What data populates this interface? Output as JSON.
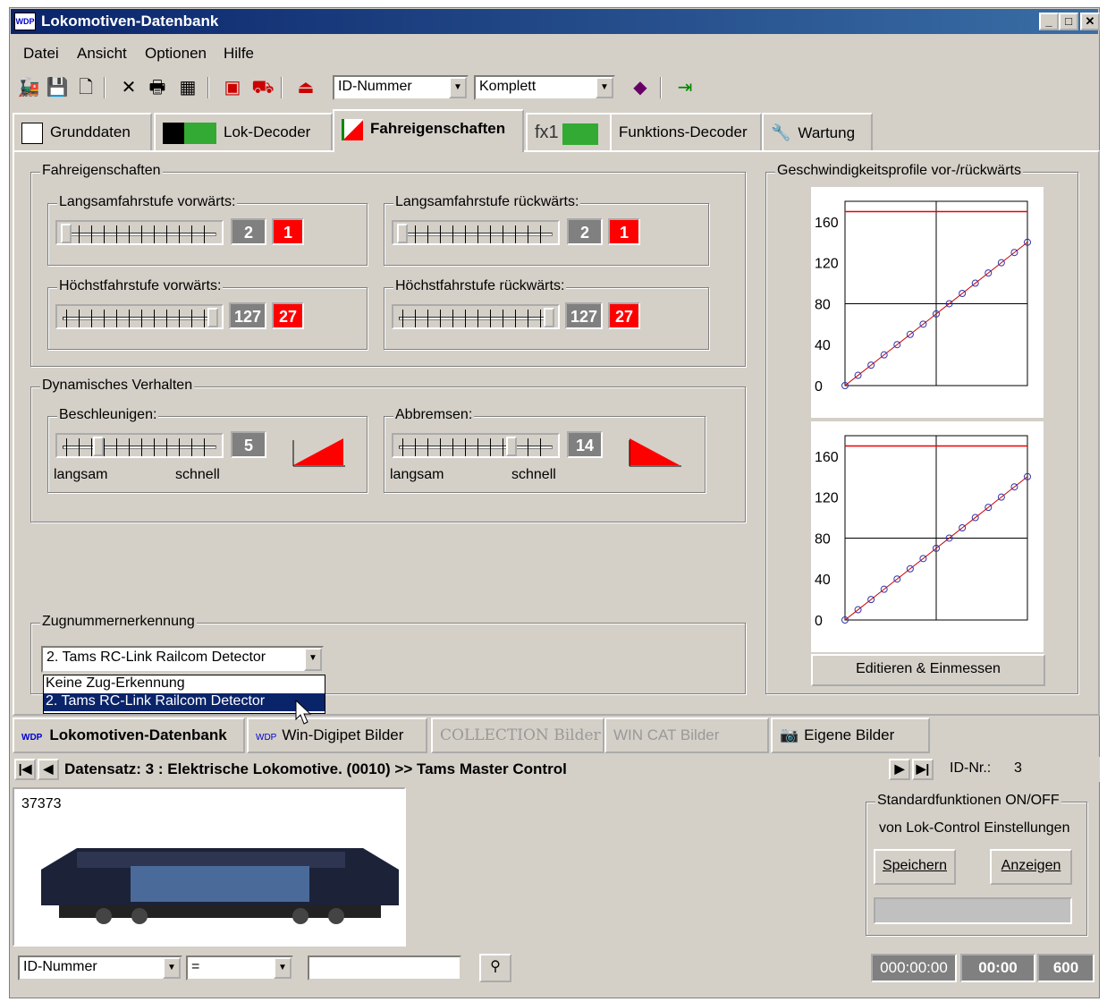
{
  "window": {
    "title": "Lokomotiven-Datenbank",
    "icon_text": "WDP"
  },
  "menu": [
    {
      "label": "Datei"
    },
    {
      "label": "Ansicht"
    },
    {
      "label": "Optionen"
    },
    {
      "label": "Hilfe"
    }
  ],
  "toolbar": {
    "field_combo": "ID-Nummer",
    "mode_combo": "Komplett"
  },
  "tabs": [
    {
      "label": "Grunddaten"
    },
    {
      "label": "Lok-Decoder"
    },
    {
      "label": "Fahreigenschaften"
    },
    {
      "label": "fx1"
    },
    {
      "label": "Funktions-Decoder"
    },
    {
      "label": "Wartung"
    }
  ],
  "fahr": {
    "legend": "Fahreigenschaften",
    "lang_vor": {
      "label": "Langsamfahrstufe vorwärts:",
      "value": "2",
      "red": "1"
    },
    "lang_rueck": {
      "label": "Langsamfahrstufe rückwärts:",
      "value": "2",
      "red": "1"
    },
    "hoch_vor": {
      "label": "Höchstfahrstufe vorwärts:",
      "value": "127",
      "red": "27"
    },
    "hoch_rueck": {
      "label": "Höchstfahrstufe rückwärts:",
      "value": "127",
      "red": "27"
    }
  },
  "dyn": {
    "legend": "Dynamisches Verhalten",
    "beschl": {
      "label": "Beschleunigen:",
      "value": "5",
      "slow": "langsam",
      "fast": "schnell"
    },
    "brems": {
      "label": "Abbremsen:",
      "value": "14",
      "slow": "langsam",
      "fast": "schnell"
    }
  },
  "zug": {
    "legend": "Zugnummernerkennung",
    "selected": "2. Tams RC-Link Railcom Detector",
    "options": [
      "Keine Zug-Erkennung",
      "2. Tams RC-Link Railcom Detector"
    ]
  },
  "profile": {
    "legend": "Geschwindigkeitsprofile vor-/rückwärts",
    "button": "Editieren & Einmessen"
  },
  "chart_data": [
    {
      "type": "line",
      "yticks": [
        "160",
        "120",
        "80",
        "40",
        "0"
      ],
      "ylim": [
        0,
        180
      ],
      "series": [
        {
          "values": [
            0,
            10,
            20,
            30,
            40,
            50,
            60,
            70,
            80,
            90,
            100,
            110,
            120,
            130,
            140
          ]
        }
      ],
      "max_line": 170
    },
    {
      "type": "line",
      "yticks": [
        "160",
        "120",
        "80",
        "40",
        "0"
      ],
      "ylim": [
        0,
        180
      ],
      "series": [
        {
          "values": [
            0,
            10,
            20,
            30,
            40,
            50,
            60,
            70,
            80,
            90,
            100,
            110,
            120,
            130,
            140
          ]
        }
      ],
      "max_line": 170
    }
  ],
  "lowtabs": [
    {
      "label": "Lokomotiven-Datenbank"
    },
    {
      "label": "Win-Digipet Bilder"
    },
    {
      "label": "COLLECTION Bilder"
    },
    {
      "label": "WIN CAT Bilder"
    },
    {
      "label": "Eigene Bilder"
    }
  ],
  "record": {
    "text": "Datensatz:  3 : Elektrische Lokomotive.  (0010) >> Tams Master Control",
    "id_label": "ID-Nr.:",
    "id_value": "3"
  },
  "image": {
    "caption": "37373"
  },
  "std": {
    "legend": "Standardfunktionen ON/OFF",
    "sub": "von Lok-Control Einstellungen",
    "save": "Speichern",
    "show": "Anzeigen"
  },
  "search": {
    "field": "ID-Nummer",
    "op": "=",
    "value": ""
  },
  "status": {
    "time1": "000:00:00",
    "time2": "00:00",
    "count": "600"
  }
}
